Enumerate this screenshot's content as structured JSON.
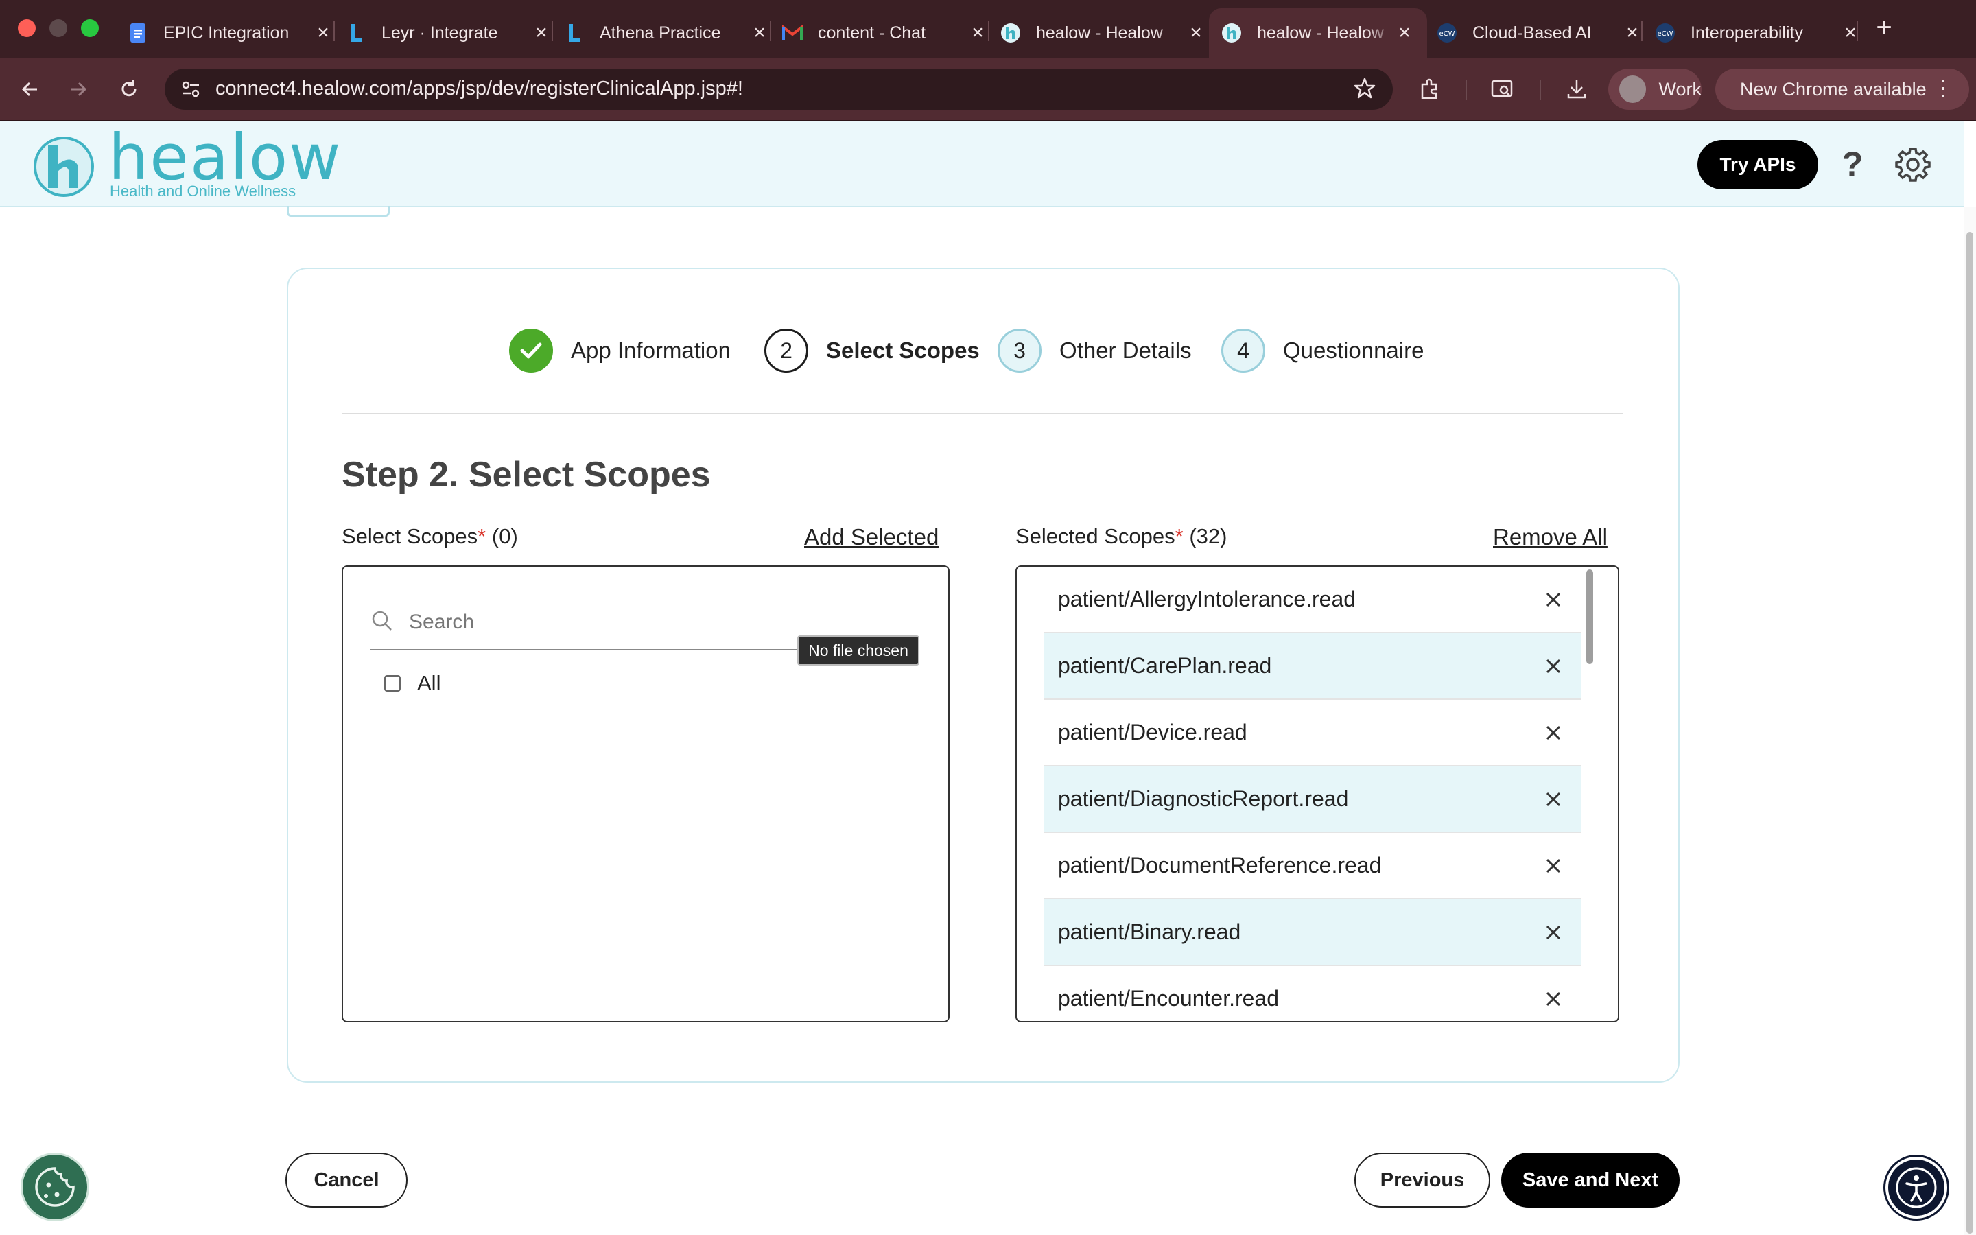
{
  "browser": {
    "tabs": [
      {
        "title": "EPIC Integration",
        "icon": "google-docs-icon"
      },
      {
        "title": "Leyr · Integrate",
        "icon": "leyr-icon"
      },
      {
        "title": "Athena Practice",
        "icon": "leyr-icon"
      },
      {
        "title": "content - Chat",
        "icon": "gmail-icon"
      },
      {
        "title": "healow - Healow",
        "icon": "healow-icon"
      },
      {
        "title": "healow - Healow",
        "icon": "healow-icon"
      },
      {
        "title": "Cloud-Based AI",
        "icon": "ecw-icon"
      },
      {
        "title": "Interoperability",
        "icon": "ecw-icon"
      }
    ],
    "active_tab_index": 5,
    "url": "connect4.healow.com/apps/jsp/dev/registerClinicalApp.jsp#!",
    "profile_label": "Work",
    "update_label": "New Chrome available",
    "colors": {
      "frame": "#3a1f24",
      "toolbar": "#512b32"
    }
  },
  "header": {
    "logo_word": "healow",
    "logo_tagline": "Health and Online Wellness",
    "try_apis_label": "Try APIs",
    "help_label": "?",
    "colors": {
      "brand": "#3fb3c3",
      "header_bg": "#ebf8fb"
    }
  },
  "stepper": {
    "steps": [
      {
        "number": "1",
        "label": "App Information",
        "state": "done"
      },
      {
        "number": "2",
        "label": "Select Scopes",
        "state": "current"
      },
      {
        "number": "3",
        "label": "Other Details",
        "state": "todo"
      },
      {
        "number": "4",
        "label": "Questionnaire",
        "state": "todo"
      }
    ],
    "colors": {
      "done": "#4caa29",
      "todo_bg": "#e5f5f8"
    }
  },
  "main": {
    "step_title": "Step 2. Select Scopes",
    "available": {
      "heading": "Select Scopes",
      "required_mark": "*",
      "count": "(0)",
      "add_label": "Add Selected",
      "search_placeholder": "Search",
      "file_tooltip": "No file chosen",
      "all_label": "All",
      "all_checked": false
    },
    "selected": {
      "heading": "Selected Scopes",
      "required_mark": "*",
      "count": "(32)",
      "remove_all_label": "Remove All",
      "items": [
        "patient/AllergyIntolerance.read",
        "patient/CarePlan.read",
        "patient/Device.read",
        "patient/DiagnosticReport.read",
        "patient/DocumentReference.read",
        "patient/Binary.read",
        "patient/Encounter.read"
      ]
    }
  },
  "footer": {
    "cancel_label": "Cancel",
    "previous_label": "Previous",
    "save_next_label": "Save and Next"
  }
}
